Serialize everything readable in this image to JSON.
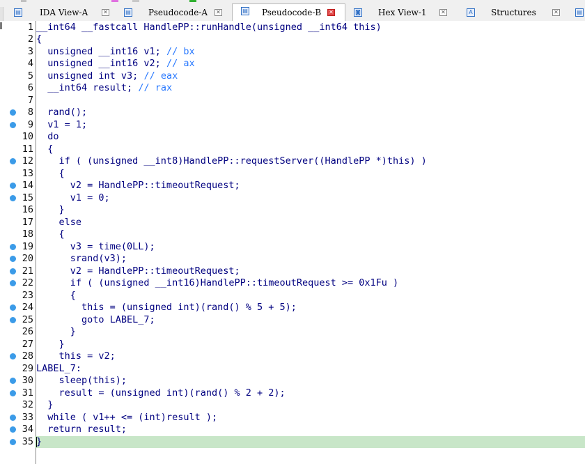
{
  "tabs": [
    {
      "label": "IDA View-A",
      "icon": "ida-view-icon",
      "active": false
    },
    {
      "label": "Pseudocode-A",
      "icon": "pseudocode-icon",
      "active": false
    },
    {
      "label": "Pseudocode-B",
      "icon": "pseudocode-icon",
      "active": true
    },
    {
      "label": "Hex View-1",
      "icon": "hex-view-icon",
      "active": false
    },
    {
      "label": "Structures",
      "icon": "structures-icon",
      "active": false
    }
  ],
  "icon_glyphs": {
    "ida": "▤",
    "pseudo": "▤",
    "hex": "◙",
    "struct": "A",
    "close": "✕"
  },
  "colors": {
    "accent_breakpoint": "#3b9be8",
    "highlight_line": "#c8e6c8",
    "code_text": "#000080",
    "comment": "#2979ff",
    "active_close": "#e04848"
  },
  "code": {
    "lines": [
      {
        "n": "1",
        "bp": false,
        "text": "__int64 __fastcall HandlePP::runHandle(unsigned __int64 this)"
      },
      {
        "n": "2",
        "bp": false,
        "text": "{"
      },
      {
        "n": "3",
        "bp": false,
        "text": "  unsigned __int16 v1; // bx"
      },
      {
        "n": "4",
        "bp": false,
        "text": "  unsigned __int16 v2; // ax"
      },
      {
        "n": "5",
        "bp": false,
        "text": "  unsigned int v3; // eax"
      },
      {
        "n": "6",
        "bp": false,
        "text": "  __int64 result; // rax"
      },
      {
        "n": "7",
        "bp": false,
        "text": ""
      },
      {
        "n": "8",
        "bp": true,
        "text": "  rand();"
      },
      {
        "n": "9",
        "bp": true,
        "text": "  v1 = 1;"
      },
      {
        "n": "10",
        "bp": false,
        "text": "  do"
      },
      {
        "n": "11",
        "bp": false,
        "text": "  {"
      },
      {
        "n": "12",
        "bp": true,
        "text": "    if ( (unsigned __int8)HandlePP::requestServer((HandlePP *)this) )"
      },
      {
        "n": "13",
        "bp": false,
        "text": "    {"
      },
      {
        "n": "14",
        "bp": true,
        "text": "      v2 = HandlePP::timeoutRequest;"
      },
      {
        "n": "15",
        "bp": true,
        "text": "      v1 = 0;"
      },
      {
        "n": "16",
        "bp": false,
        "text": "    }"
      },
      {
        "n": "17",
        "bp": false,
        "text": "    else"
      },
      {
        "n": "18",
        "bp": false,
        "text": "    {"
      },
      {
        "n": "19",
        "bp": true,
        "text": "      v3 = time(0LL);"
      },
      {
        "n": "20",
        "bp": true,
        "text": "      srand(v3);"
      },
      {
        "n": "21",
        "bp": true,
        "text": "      v2 = HandlePP::timeoutRequest;"
      },
      {
        "n": "22",
        "bp": true,
        "text": "      if ( (unsigned __int16)HandlePP::timeoutRequest >= 0x1Fu )"
      },
      {
        "n": "23",
        "bp": false,
        "text": "      {"
      },
      {
        "n": "24",
        "bp": true,
        "text": "        this = (unsigned int)(rand() % 5 + 5);"
      },
      {
        "n": "25",
        "bp": true,
        "text": "        goto LABEL_7;"
      },
      {
        "n": "26",
        "bp": false,
        "text": "      }"
      },
      {
        "n": "27",
        "bp": false,
        "text": "    }"
      },
      {
        "n": "28",
        "bp": true,
        "text": "    this = v2;"
      },
      {
        "n": "29",
        "bp": false,
        "text": "LABEL_7:"
      },
      {
        "n": "30",
        "bp": true,
        "text": "    sleep(this);"
      },
      {
        "n": "31",
        "bp": true,
        "text": "    result = (unsigned int)(rand() % 2 + 2);"
      },
      {
        "n": "32",
        "bp": false,
        "text": "  }"
      },
      {
        "n": "33",
        "bp": true,
        "text": "  while ( v1++ <= (int)result );"
      },
      {
        "n": "34",
        "bp": true,
        "text": "  return result;"
      },
      {
        "n": "35",
        "bp": true,
        "text": "}"
      }
    ]
  }
}
